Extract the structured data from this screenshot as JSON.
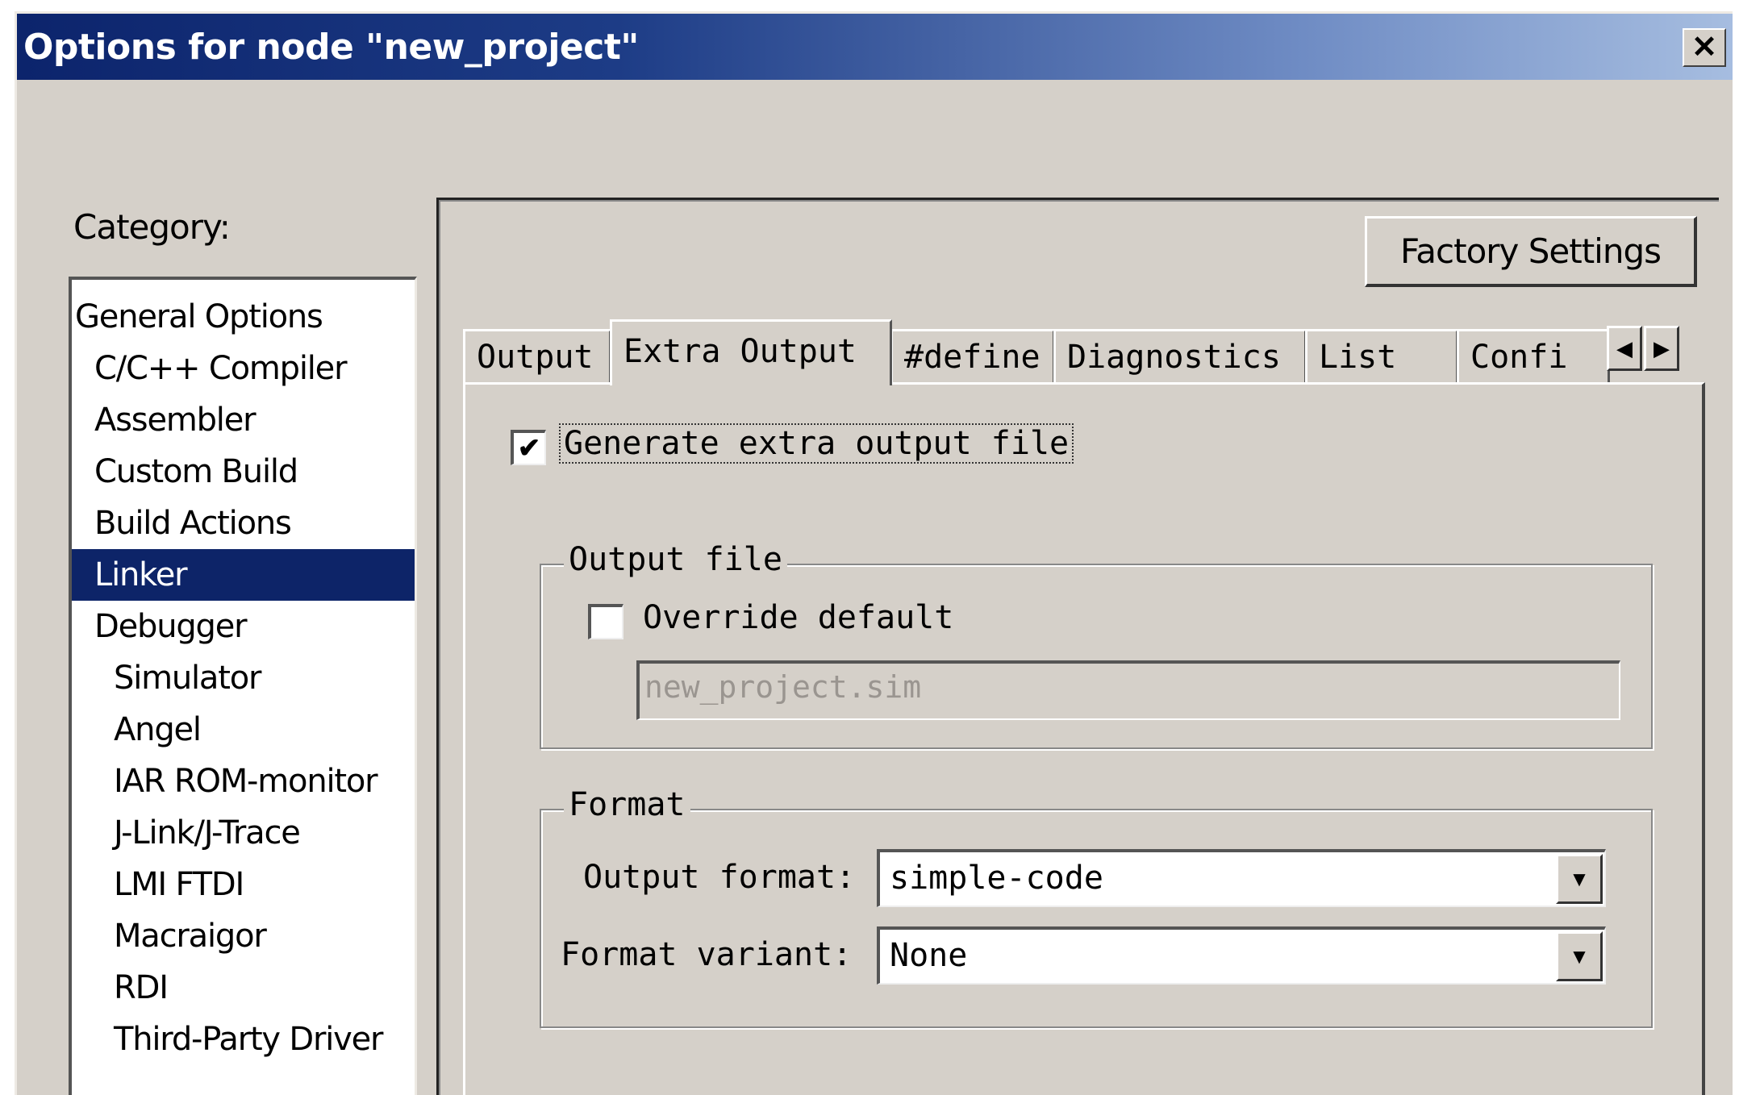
{
  "window": {
    "title": "Options for node \"new_project\"",
    "close_glyph": "✕"
  },
  "category": {
    "label": "Category:",
    "items": [
      {
        "label": "General Options",
        "level": 0
      },
      {
        "label": "C/C++ Compiler",
        "level": 1
      },
      {
        "label": "Assembler",
        "level": 1
      },
      {
        "label": "Custom Build",
        "level": 1
      },
      {
        "label": "Build Actions",
        "level": 1
      },
      {
        "label": "Linker",
        "level": 1,
        "selected": true
      },
      {
        "label": "Debugger",
        "level": 1
      },
      {
        "label": "Simulator",
        "level": 2
      },
      {
        "label": "Angel",
        "level": 2
      },
      {
        "label": "IAR ROM-monitor",
        "level": 2
      },
      {
        "label": "J-Link/J-Trace",
        "level": 2
      },
      {
        "label": "LMI FTDI",
        "level": 2
      },
      {
        "label": "Macraigor",
        "level": 2
      },
      {
        "label": "RDI",
        "level": 2
      },
      {
        "label": "Third-Party Driver",
        "level": 2
      }
    ]
  },
  "panel": {
    "factory_button": "Factory Settings",
    "tabs": [
      "Output",
      "Extra Output",
      "#define",
      "Diagnostics",
      "List",
      "Confi"
    ],
    "active_tab": "Extra Output",
    "scroll_left_glyph": "◀",
    "scroll_right_glyph": "▶"
  },
  "extra_output": {
    "generate_label": "Generate extra output file",
    "generate_checked": true,
    "output_file_group": "Output file",
    "override_label": "Override default",
    "override_checked": false,
    "output_filename": "new_project.sim",
    "format_group": "Format",
    "output_format_label": "Output format:",
    "output_format_value": "simple-code",
    "format_variant_label": "Format variant:",
    "format_variant_value": "None"
  },
  "icons": {
    "checkmark": "✔",
    "dropdown": "▼"
  },
  "colors": {
    "title_bar_start": "#0c246c",
    "title_bar_end": "#a6bde0",
    "selection": "#0d2468",
    "dialog_bg": "#d5d0c9"
  }
}
